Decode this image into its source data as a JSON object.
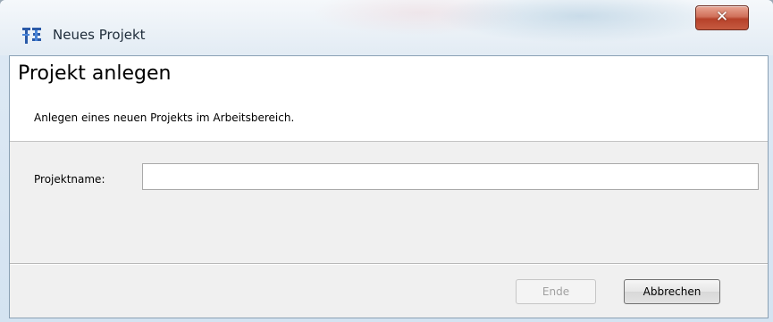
{
  "window": {
    "title": "Neues Projekt",
    "app_icon": "eclipse-wizard-icon",
    "close_icon": "close-icon"
  },
  "wizard": {
    "heading": "Projekt anlegen",
    "description": "Anlegen eines neuen Projekts im Arbeitsbereich.",
    "project_name_label": "Projektname:",
    "project_name_value": "",
    "project_name_placeholder": ""
  },
  "buttons": {
    "finish_label": "Ende",
    "finish_enabled": false,
    "cancel_label": "Abbrechen"
  },
  "colors": {
    "close_button": "#c65a40",
    "disabled_text": "#a0a0a0"
  }
}
